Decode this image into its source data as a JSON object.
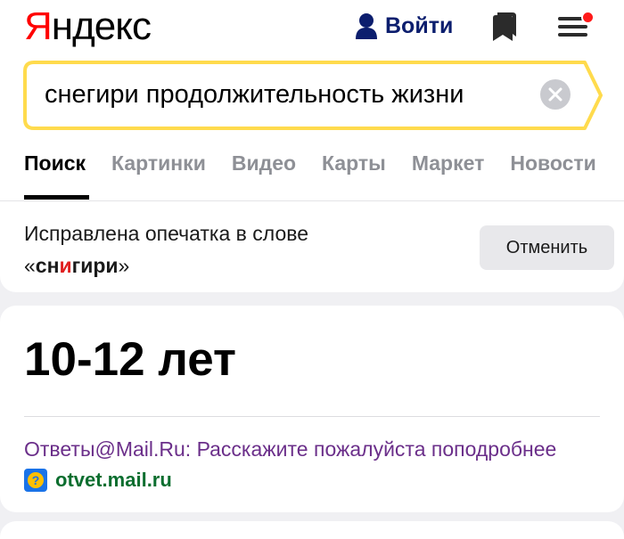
{
  "header": {
    "logo_first": "Я",
    "logo_rest": "ндекс",
    "login_label": "Войти",
    "icons": {
      "login": "user-icon",
      "bookmarks": "bookmark-icon",
      "menu": "hamburger-menu-icon",
      "notification": "notification-dot"
    }
  },
  "search": {
    "query": "снегири продолжительность жизни",
    "clear_icon": "close-icon",
    "accent_color": "#ffdb4d"
  },
  "tabs": [
    {
      "label": "Поиск",
      "active": true
    },
    {
      "label": "Картинки",
      "active": false
    },
    {
      "label": "Видео",
      "active": false
    },
    {
      "label": "Карты",
      "active": false
    },
    {
      "label": "Маркет",
      "active": false
    },
    {
      "label": "Новости",
      "active": false
    }
  ],
  "correction": {
    "line1": "Исправлена опечатка в слове",
    "quote_open": "«",
    "word_before": "сн",
    "word_highlight": "и",
    "word_after": "гири",
    "quote_close": "»",
    "cancel_label": "Отменить"
  },
  "answer": {
    "value": "10-12 лет",
    "source_title": "Ответы@Mail.Ru: Расскажите пожалуйста поподробнее",
    "source_domain": "otvet.mail.ru",
    "favicon_glyph": "?"
  }
}
